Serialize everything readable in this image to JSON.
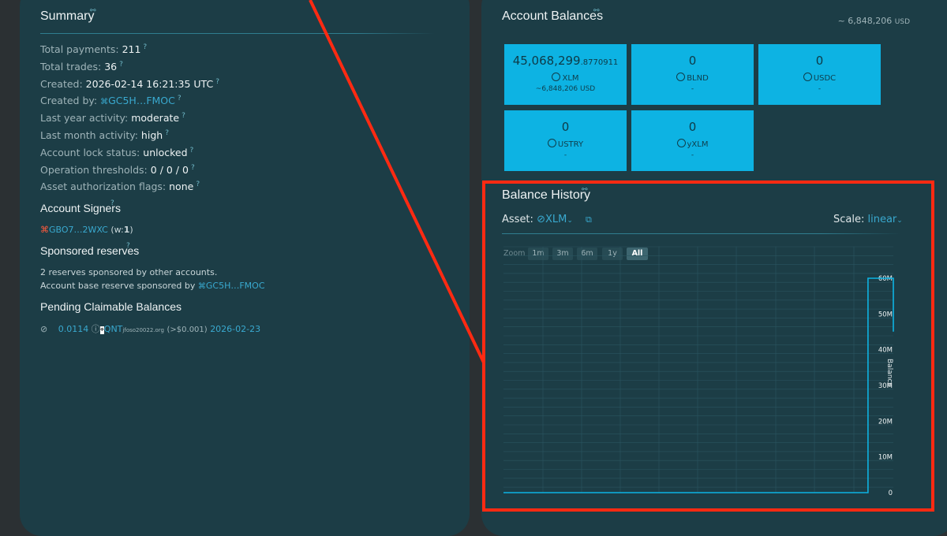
{
  "summary": {
    "title": "Summary",
    "rows": [
      {
        "label": "Total payments:",
        "value": "211"
      },
      {
        "label": "Total trades:",
        "value": "36"
      },
      {
        "label": "Created:",
        "value": "2026-02-14 16:21:35 UTC"
      },
      {
        "label": "Created by:",
        "value": "GC5H…FMOC"
      },
      {
        "label": "Last year activity:",
        "value": "moderate"
      },
      {
        "label": "Last month activity:",
        "value": "high"
      },
      {
        "label": "Account lock status:",
        "value": "unlocked"
      },
      {
        "label": "Operation thresholds:",
        "value": "0 / 0 / 0"
      },
      {
        "label": "Asset authorization flags:",
        "value": "none"
      }
    ],
    "signers_title": "Account Signers",
    "signer": {
      "address": "GBO7…2WXC",
      "weight_prefix": "(w:",
      "weight": "1",
      "weight_suffix": ")"
    },
    "sponsored_title": "Sponsored reserves",
    "sponsored_line1": "2 reserves sponsored by other accounts.",
    "sponsored_line2": "Account base reserve sponsored by",
    "sponsor_address": "GC5H…FMOC",
    "claimable_title": "Pending Claimable Balances",
    "claimable": {
      "amount": "0.0114",
      "asset": "QNT",
      "domain": "jfoso20022.org",
      "usd": "(>$0.001)",
      "date": "2026-02-23"
    }
  },
  "balances": {
    "title": "Account Balances",
    "total": "~ 6,848,206",
    "total_unit": "USD",
    "tiles": [
      {
        "amount": "45,068,299",
        "fraction": ".8770911",
        "code": "XLM",
        "usd": "~6,848,206 USD",
        "icon": "stellar-icon"
      },
      {
        "amount": "0",
        "fraction": "",
        "code": "BLND",
        "usd": "-",
        "icon": "blend-icon"
      },
      {
        "amount": "0",
        "fraction": "",
        "code": "USDC",
        "usd": "-",
        "icon": "usdc-icon"
      },
      {
        "amount": "0",
        "fraction": "",
        "code": "USTRY",
        "usd": "-",
        "icon": "ustry-icon"
      },
      {
        "amount": "0",
        "fraction": "",
        "code": "yXLM",
        "usd": "-",
        "icon": "yxlm-icon"
      }
    ]
  },
  "history": {
    "title": "Balance History",
    "asset_label": "Asset:",
    "asset_value": "XLM",
    "scale_label": "Scale:",
    "scale_value": "linear",
    "zoom_label": "Zoom",
    "zoom_buttons": [
      "1m",
      "3m",
      "6m",
      "1y",
      "All"
    ],
    "active_zoom": "All",
    "colors": {
      "line": "#0db3e3",
      "highlight": "#ff2a12"
    }
  },
  "chart_data": {
    "type": "line",
    "title": "",
    "xlabel": "",
    "ylabel": "Balance",
    "y_ticks": [
      "60M",
      "50M",
      "40M",
      "30M",
      "20M",
      "10M",
      "0"
    ],
    "ylim": [
      0,
      60000000
    ],
    "series": [
      {
        "x": [
          0,
          0.93,
          0.935,
          0.935,
          1.0,
          1.0
        ],
        "y": [
          0,
          0,
          0,
          60000000,
          60000000,
          45068299
        ]
      }
    ],
    "grid": true
  }
}
